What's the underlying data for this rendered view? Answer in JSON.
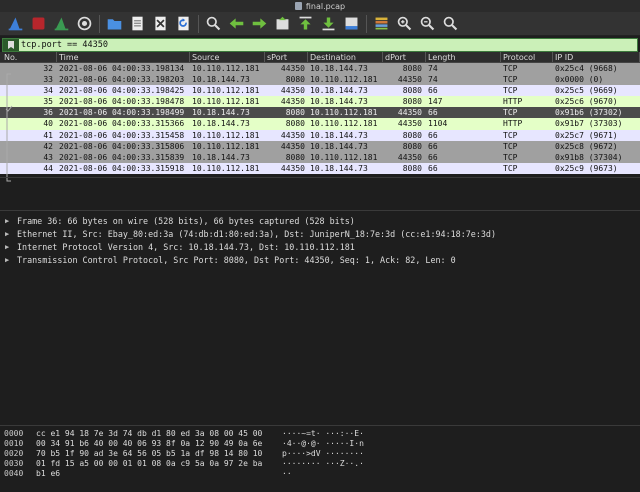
{
  "window": {
    "title": "final.pcap"
  },
  "toolbar": {
    "buttons": [
      "shark-fin-start-icon",
      "stop-capture-icon",
      "restart-capture-icon",
      "capture-options-icon",
      "open-file-icon",
      "save-file-icon",
      "close-file-icon",
      "reload-file-icon",
      "find-packet-icon",
      "go-back-icon",
      "go-forward-icon",
      "go-to-packet-icon",
      "go-first-icon",
      "go-last-icon",
      "autoscroll-icon",
      "colorize-icon",
      "zoom-in-icon",
      "zoom-out-icon",
      "normal-size-icon"
    ]
  },
  "filter": {
    "value": "tcp.port == 44350"
  },
  "columns": [
    "No.",
    "Time",
    "Source",
    "sPort",
    "Destination",
    "dPort",
    "Length",
    "Protocol",
    "IP ID"
  ],
  "packets": [
    {
      "no": "32",
      "time": "2021-08-06 04:00:33.198134",
      "src": "10.110.112.181",
      "sport": "44350",
      "dst": "10.18.144.73",
      "dport": "8080",
      "len": "74",
      "proto": "TCP",
      "ipid": "0x25c4 (9668)",
      "style": "row-grey"
    },
    {
      "no": "33",
      "time": "2021-08-06 04:00:33.198203",
      "src": "10.18.144.73",
      "sport": "8080",
      "dst": "10.110.112.181",
      "dport": "44350",
      "len": "74",
      "proto": "TCP",
      "ipid": "0x0000 (0)",
      "style": "row-grey"
    },
    {
      "no": "34",
      "time": "2021-08-06 04:00:33.198425",
      "src": "10.110.112.181",
      "sport": "44350",
      "dst": "10.18.144.73",
      "dport": "8080",
      "len": "66",
      "proto": "TCP",
      "ipid": "0x25c5 (9669)",
      "style": "row-tcp"
    },
    {
      "no": "35",
      "time": "2021-08-06 04:00:33.198478",
      "src": "10.110.112.181",
      "sport": "44350",
      "dst": "10.18.144.73",
      "dport": "8080",
      "len": "147",
      "proto": "HTTP",
      "ipid": "0x25c6 (9670)",
      "style": "row-http"
    },
    {
      "no": "36",
      "time": "2021-08-06 04:00:33.198499",
      "src": "10.18.144.73",
      "sport": "8080",
      "dst": "10.110.112.181",
      "dport": "44350",
      "len": "66",
      "proto": "TCP",
      "ipid": "0x91b6 (37302)",
      "style": "row-sel"
    },
    {
      "no": "40",
      "time": "2021-08-06 04:00:33.315366",
      "src": "10.18.144.73",
      "sport": "8080",
      "dst": "10.110.112.181",
      "dport": "44350",
      "len": "1104",
      "proto": "HTTP",
      "ipid": "0x91b7 (37303)",
      "style": "row-http"
    },
    {
      "no": "41",
      "time": "2021-08-06 04:00:33.315458",
      "src": "10.110.112.181",
      "sport": "44350",
      "dst": "10.18.144.73",
      "dport": "8080",
      "len": "66",
      "proto": "TCP",
      "ipid": "0x25c7 (9671)",
      "style": "row-tcp"
    },
    {
      "no": "42",
      "time": "2021-08-06 04:00:33.315806",
      "src": "10.110.112.181",
      "sport": "44350",
      "dst": "10.18.144.73",
      "dport": "8080",
      "len": "66",
      "proto": "TCP",
      "ipid": "0x25c8 (9672)",
      "style": "row-grey"
    },
    {
      "no": "43",
      "time": "2021-08-06 04:00:33.315839",
      "src": "10.18.144.73",
      "sport": "8080",
      "dst": "10.110.112.181",
      "dport": "44350",
      "len": "66",
      "proto": "TCP",
      "ipid": "0x91b8 (37304)",
      "style": "row-grey"
    },
    {
      "no": "44",
      "time": "2021-08-06 04:00:33.315918",
      "src": "10.110.112.181",
      "sport": "44350",
      "dst": "10.18.144.73",
      "dport": "8080",
      "len": "66",
      "proto": "TCP",
      "ipid": "0x25c9 (9673)",
      "style": "row-tcp"
    }
  ],
  "details": [
    "Frame 36: 66 bytes on wire (528 bits), 66 bytes captured (528 bits)",
    "Ethernet II, Src: Ebay_80:ed:3a (74:db:d1:80:ed:3a), Dst: JuniperN_18:7e:3d (cc:e1:94:18:7e:3d)",
    "Internet Protocol Version 4, Src: 10.18.144.73, Dst: 10.110.112.181",
    "Transmission Control Protocol, Src Port: 8080, Dst Port: 44350, Seq: 1, Ack: 82, Len: 0"
  ],
  "bytes": [
    {
      "off": "0000",
      "hex": "cc e1 94 18 7e 3d 74 db  d1 80 ed 3a 08 00 45 00",
      "ascii": "····~=t· ···:··E·"
    },
    {
      "off": "0010",
      "hex": "00 34 91 b6 40 00 40 06  93 8f 0a 12 90 49 0a 6e",
      "ascii": "·4··@·@· ·····I·n"
    },
    {
      "off": "0020",
      "hex": "70 b5 1f 90 ad 3e 64 56  05 b5 1a df 98 14 80 10",
      "ascii": "p····>dV ········"
    },
    {
      "off": "0030",
      "hex": "01 fd 15 a5 00 00 01 01  08 0a c9 5a 0a 97 2e ba",
      "ascii": "········ ···Z··.·"
    },
    {
      "off": "0040",
      "hex": "b1 e6",
      "ascii": "··"
    }
  ]
}
